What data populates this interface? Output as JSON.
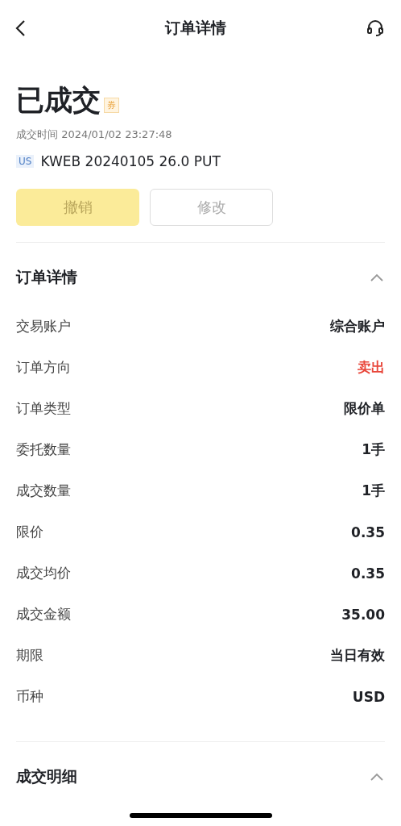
{
  "nav": {
    "title": "订单详情"
  },
  "status": {
    "title": "已成交",
    "badge": "券",
    "time": "成交时间 2024/01/02 23:27:48",
    "market": "US",
    "instrument": "KWEB 20240105 26.0 PUT"
  },
  "buttons": [
    {
      "label": "撤销",
      "kind": "primary",
      "disabled": true
    },
    {
      "label": "修改",
      "kind": "outline",
      "disabled": true
    }
  ],
  "sections": [
    {
      "title": "订单详情",
      "expanded": true,
      "rows": [
        {
          "label": "交易账户",
          "value": "综合账户",
          "color": "#1f2126"
        },
        {
          "label": "订单方向",
          "value": "卖出",
          "color": "#e8463a"
        },
        {
          "label": "订单类型",
          "value": "限价单",
          "color": "#1f2126"
        },
        {
          "label": "委托数量",
          "value": "1手",
          "color": "#1f2126"
        },
        {
          "label": "成交数量",
          "value": "1手",
          "color": "#1f2126"
        },
        {
          "label": "限价",
          "value": "0.35",
          "color": "#1f2126"
        },
        {
          "label": "成交均价",
          "value": "0.35",
          "color": "#1f2126"
        },
        {
          "label": "成交金额",
          "value": "35.00",
          "color": "#1f2126"
        },
        {
          "label": "期限",
          "value": "当日有效",
          "color": "#1f2126"
        },
        {
          "label": "币种",
          "value": "USD",
          "color": "#1f2126"
        }
      ]
    },
    {
      "title": "成交明细",
      "expanded": true
    }
  ]
}
